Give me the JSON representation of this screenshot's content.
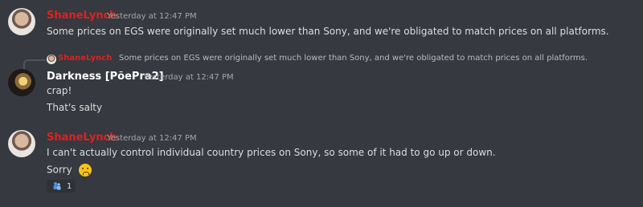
{
  "messages": [
    {
      "author": "ShaneLynch",
      "timestamp": "Yesterday at 12:47 PM",
      "lines": [
        "Some prices on EGS were originally set much lower than Sony, and we're obligated to match prices on all platforms."
      ]
    },
    {
      "reply_author": "ShaneLynch",
      "reply_text": "Some prices on EGS were originally set much lower than Sony, and we're obligated to match prices on all platforms.",
      "author": "Darkness [PõePra2]",
      "timestamp": "Yesterday at 12:47 PM",
      "lines": [
        "crap!",
        "That's salty"
      ]
    },
    {
      "author": "ShaneLynch",
      "timestamp": "Yesterday at 12:47 PM",
      "lines": [
        "I can't actually control individual country prices on Sony, so some of it had to go up or down.",
        "Sorry"
      ],
      "emoji": "frowning-face",
      "reaction": {
        "emoji": "people-icon",
        "count": "1"
      }
    }
  ]
}
